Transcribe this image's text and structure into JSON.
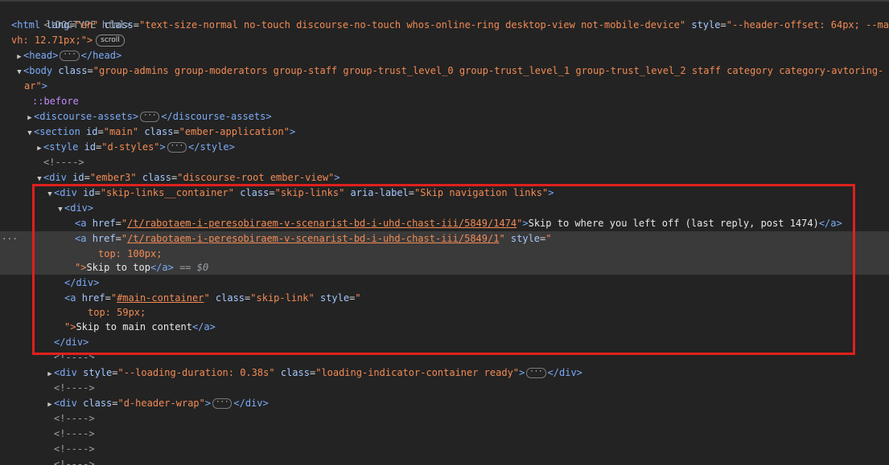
{
  "lines": {
    "doctype": "<!DOCTYPE html>",
    "html_open": "<html",
    "html_lang_attr": "lang",
    "html_lang_val": "\"en\"",
    "html_class_attr": "class",
    "html_class_val": "\"text-size-normal no-touch discourse-no-touch whos-online-ring desktop-view not-mobile-device\"",
    "html_style_attr": "style",
    "html_style_val": "\"--header-offset: 64px; --ma",
    "html_cont": "vh: 12.71px;\">",
    "scroll_badge": "scroll",
    "head": "<head>",
    "head_close": "</head>",
    "body_open": "<body",
    "body_class_attr": "class",
    "body_class_val": "\"group-admins group-moderators group-staff group-trust_level_0 group-trust_level_1 group-trust_level_2 staff category category-avtoring-",
    "body_cont": "ar\"",
    "body_cont_close": ">",
    "before": "::before",
    "discourse_assets": "<discourse-assets>",
    "discourse_assets_close": "</discourse-assets>",
    "section_open": "<section",
    "section_id_attr": "id",
    "section_id_val": "\"main\"",
    "section_class_attr": "class",
    "section_class_val": "\"ember-application\"",
    "section_close_br": ">",
    "style_open": "<style",
    "style_id_attr": "id",
    "style_id_val": "\"d-styles\"",
    "style_gt": ">",
    "style_close": "</style>",
    "comment1": "<!---->",
    "div_ember_open": "<div",
    "div_ember_id_attr": "id",
    "div_ember_id_val": "\"ember3\"",
    "div_ember_class_attr": "class",
    "div_ember_class_val": "\"discourse-root ember-view\"",
    "div_ember_gt": ">",
    "skip_div_open": "<div",
    "skip_id_attr": "id",
    "skip_id_val": "\"skip-links__container\"",
    "skip_class_attr": "class",
    "skip_class_val": "\"skip-links\"",
    "skip_aria_attr": "aria-label",
    "skip_aria_val": "\"Skip navigation links\"",
    "skip_gt": ">",
    "inner_div": "<div>",
    "a1_open": "<a",
    "a1_href_attr": "href",
    "a1_href_val": "/t/rabotaem-i-peresobiraem-v-scenarist-bd-i-uhd-chast-iii/5849/1474",
    "a1_text": "Skip to where you left off (last reply, post 1474)",
    "a1_close": "</a>",
    "a2_open": "<a",
    "a2_href_attr": "href",
    "a2_href_val": "/t/rabotaem-i-peresobiraem-v-scenarist-bd-i-uhd-chast-iii/5849/1",
    "a2_style_attr": "style",
    "a2_style_q": "\"",
    "a2_css": "top: 100px;",
    "a2_text_pre": "\">",
    "a2_text": "Skip to top",
    "a2_close": "</a>",
    "a2_eq": "== $0",
    "inner_div_close": "</div>",
    "a3_open": "<a",
    "a3_href_attr": "href",
    "a3_href_val": "#main-container",
    "a3_class_attr": "class",
    "a3_class_val": "\"skip-link\"",
    "a3_style_attr": "style",
    "a3_style_q": "\"",
    "a3_css": "top: 59px;",
    "a3_text_pre": "\">",
    "a3_text": "Skip to main content",
    "a3_close": "</a>",
    "skip_div_close": "</div>",
    "comment_hidden": "<!---->",
    "loading_open": "<div",
    "loading_style_attr": "style",
    "loading_style_val": "\"--loading-duration: 0.38s\"",
    "loading_class_attr": "class",
    "loading_class_val": "\"loading-indicator-container ready\"",
    "loading_gt": ">",
    "loading_close": "</div>",
    "comment2": "<!---->",
    "header_open": "<div",
    "header_class_attr": "class",
    "header_class_val": "\"d-header-wrap\"",
    "header_gt": ">",
    "header_close": "</div>",
    "comment3": "<!---->",
    "comment4": "<!---->",
    "comment5": "<!---->",
    "comment6": "<!---->"
  },
  "gutter": {
    "dots": "···"
  },
  "ellipsis": "···",
  "colors": {
    "highlight_border": "#e0201c",
    "selected_row": "#3a3a3a"
  }
}
